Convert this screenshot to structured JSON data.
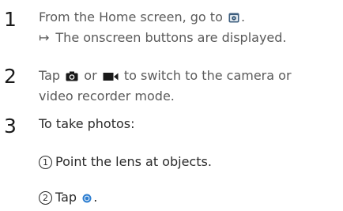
{
  "steps": [
    {
      "number": "1",
      "line1_pre": "From the Home screen, go to",
      "line1_post": ".",
      "arrow": "↦",
      "result": "The onscreen buttons are displayed."
    },
    {
      "number": "2",
      "line1_a": "Tap",
      "line1_b": "or",
      "line1_c": "to switch to the camera or",
      "line2": "video recorder mode."
    },
    {
      "number": "3",
      "heading": "To take photos:"
    }
  ],
  "substeps": [
    {
      "marker": "1",
      "text": "Point the lens at objects."
    },
    {
      "marker": "2",
      "text_pre": "Tap",
      "text_post": "."
    }
  ],
  "icons": [
    "camera-app-icon",
    "camera-icon",
    "video-camera-icon",
    "shutter-button-icon"
  ],
  "colors": {
    "text": "#5a5a5a",
    "number": "#1a1a1a",
    "shutter": "#2f7fd1"
  }
}
